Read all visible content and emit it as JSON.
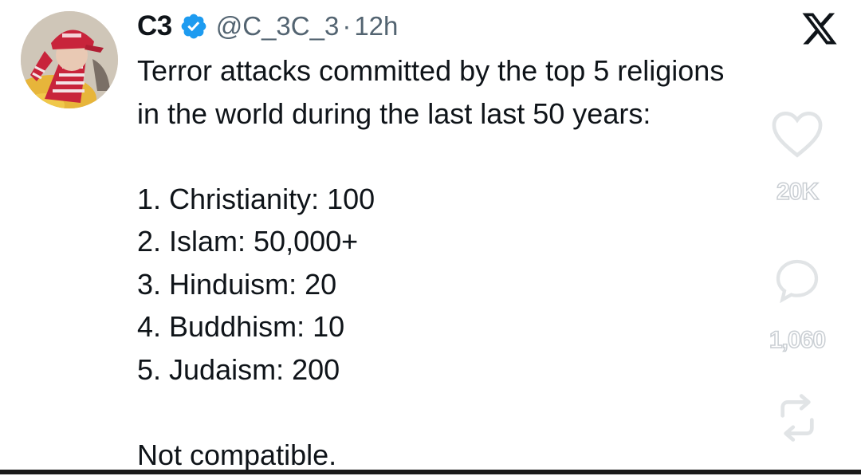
{
  "tweet": {
    "author_name": "C3",
    "handle": "@C_3C_3",
    "separator": "·",
    "time": "12h",
    "lines": [
      "Terror attacks committed by the top 5 religions",
      "in the world during the last last 50 years:"
    ],
    "list": [
      "1. Christianity: 100",
      "2. Islam: 50,000+",
      "3. Hinduism: 20",
      "4. Buddhism: 10",
      "5. Judaism: 200"
    ],
    "closing": "Not compatible."
  },
  "actions": {
    "likes": "20K",
    "comments": "1,060"
  },
  "icons": {
    "verified": "verified-badge-icon",
    "brand": "x-logo-icon",
    "like": "heart-icon",
    "comment": "comment-bubble-icon",
    "share": "repost-icon"
  },
  "colors": {
    "verified_blue": "#1d9bf0",
    "secondary_text": "#536471",
    "avatar_red": "#c8243b"
  }
}
